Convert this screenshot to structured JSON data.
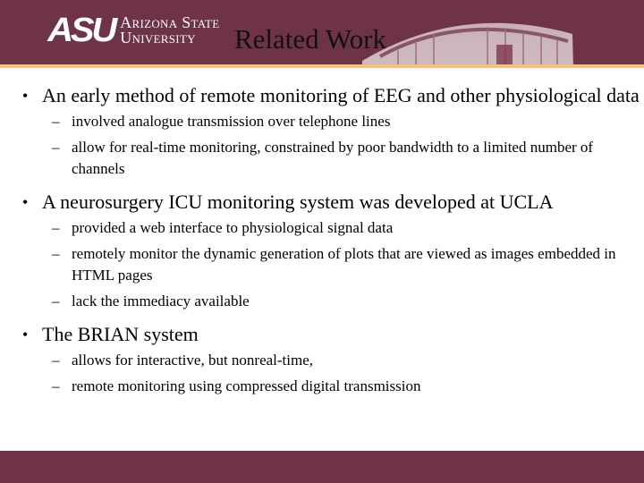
{
  "header": {
    "logo": {
      "mark": "ASU",
      "line1": "Arizona State",
      "line2": "University"
    },
    "title": "Related Work"
  },
  "colors": {
    "maroon": "#6e3446",
    "gold": "#f2c27a"
  },
  "bullets": [
    {
      "text": "An early method of remote monitoring of EEG and other physiological data",
      "sub": [
        "involved analogue transmission over telephone lines",
        "allow for real-time monitoring, constrained by poor bandwidth to a limited number of channels"
      ]
    },
    {
      "text": "A neurosurgery ICU monitoring system was developed at UCLA",
      "sub": [
        "provided a web interface to physiological signal data",
        "remotely monitor the dynamic generation of plots that are viewed as images embedded in HTML pages",
        "lack the immediacy available"
      ]
    },
    {
      "text": "The BRIAN system",
      "sub": [
        "allows for interactive, but nonreal-time,",
        "remote monitoring using compressed digital transmission"
      ]
    }
  ],
  "symbols": {
    "bullet": "•",
    "dash": "–"
  }
}
